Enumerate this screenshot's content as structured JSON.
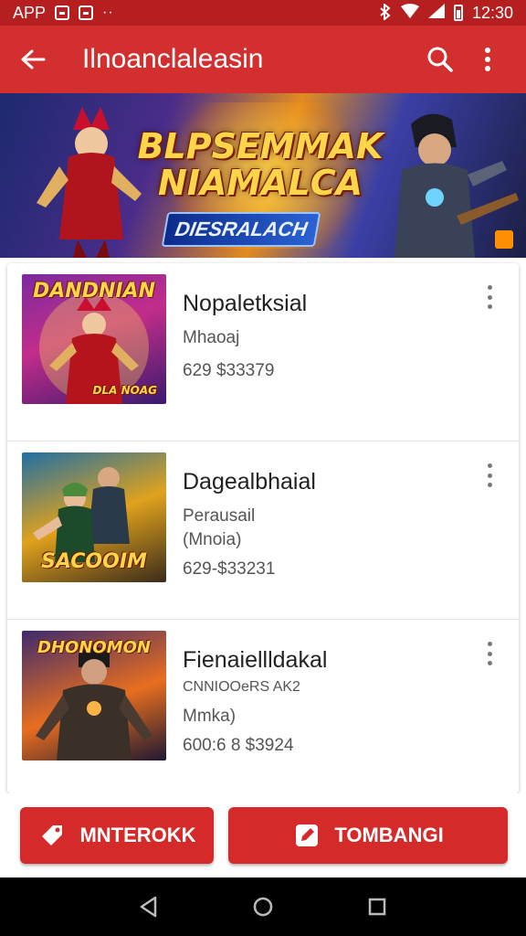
{
  "status_bar": {
    "left_label": "APP",
    "dots": "··",
    "time": "12:30"
  },
  "app_bar": {
    "title": "Ilnoanclaleasin"
  },
  "banner": {
    "title": "BLPSEMMAK NIAMALCA",
    "subtitle": "DIESRALACH"
  },
  "games": [
    {
      "name": "Nopaletksial",
      "developer": "Mhaoaj",
      "price": "629 $33379",
      "thumb_text": "DANDNIAN",
      "thumb_sub": "DLA NOAG",
      "colors": {
        "top": "#7b2aa0",
        "mid": "#c22d8a",
        "bot": "#3a1a6e"
      }
    },
    {
      "name": "Dagealbhaial",
      "developer": "Perausail",
      "extra": "(Mnoia)",
      "price": "629-$33231",
      "thumb_text": "SACOOIM",
      "thumb_sub": "",
      "colors": {
        "top": "#1f6fa5",
        "mid": "#e0a21d",
        "bot": "#3a2b1a"
      }
    },
    {
      "name": "Fienaiellldakal",
      "developer": "CNNIOOeRS AK2",
      "extra": "Mmka)",
      "price": "600:6 8 $3924",
      "thumb_text": "DHONOMON",
      "thumb_sub": "",
      "colors": {
        "top": "#3d2a6e",
        "mid": "#e86e1f",
        "bot": "#1e1832"
      }
    }
  ],
  "actions": {
    "left_label": "MNTEROKK",
    "right_label": "TOMBANGI"
  },
  "colors": {
    "primary": "#d32f2f",
    "status": "#b51f1f",
    "button": "#d42a2a"
  }
}
